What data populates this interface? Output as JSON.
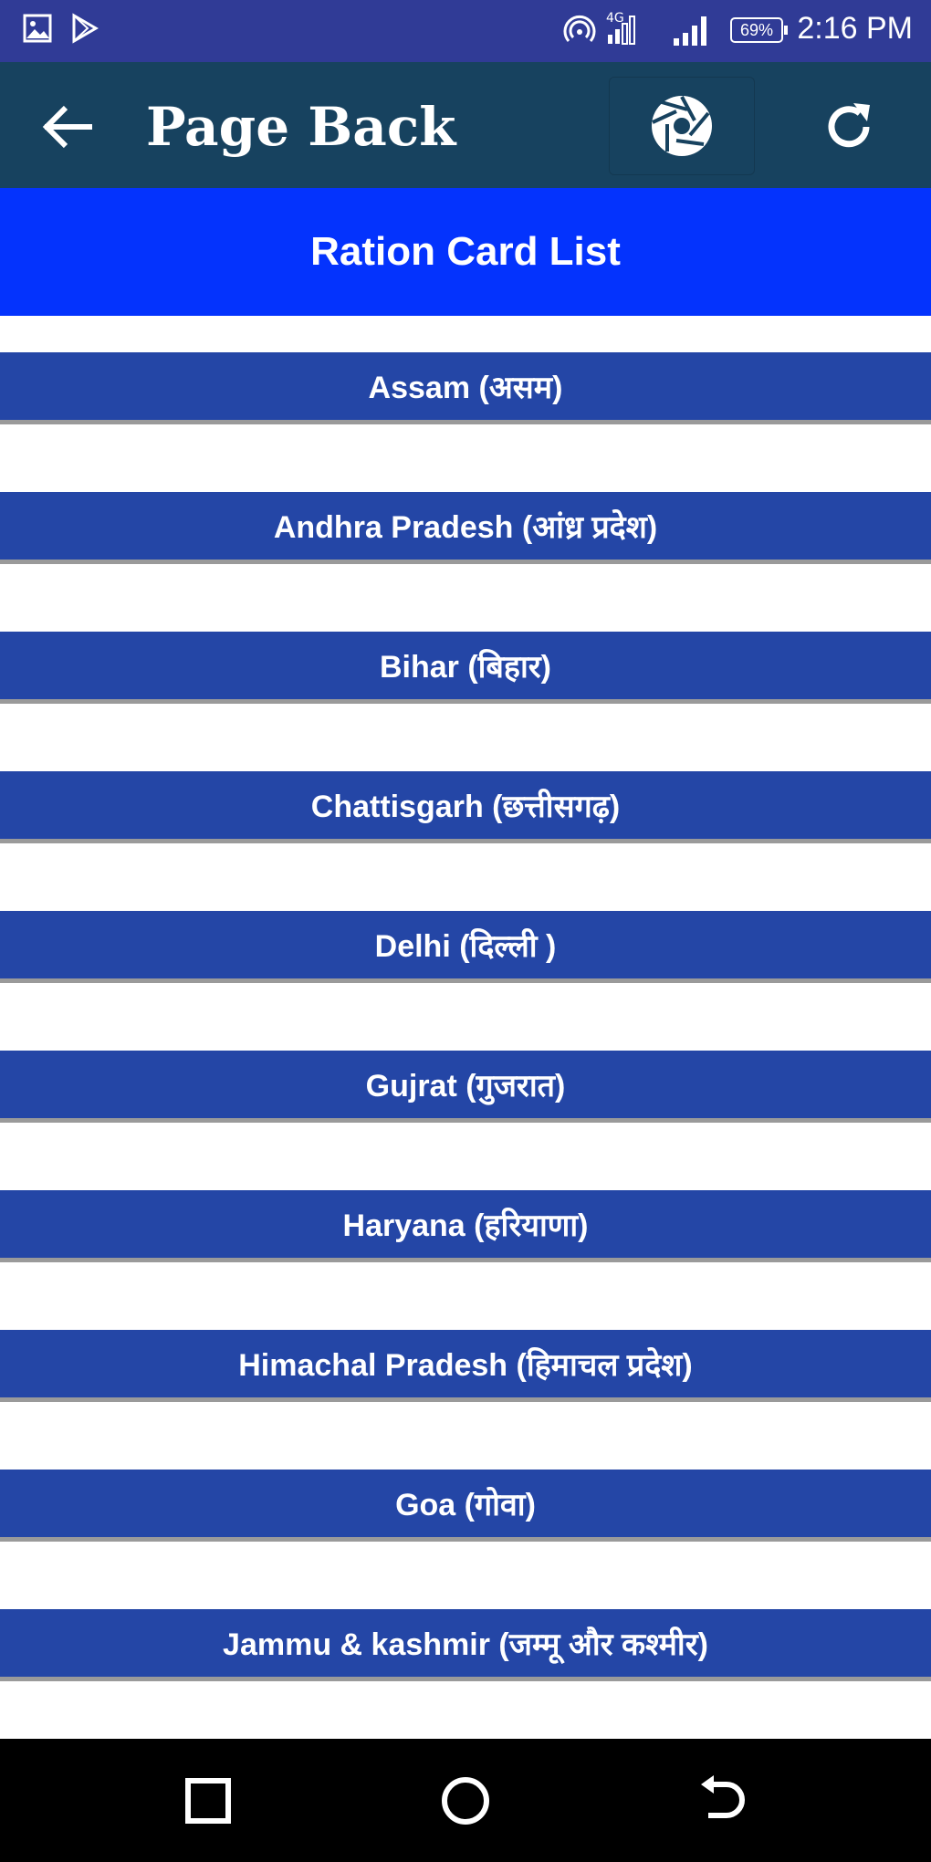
{
  "status_bar": {
    "time": "2:16 PM",
    "battery": "69%",
    "icons": [
      "image-icon",
      "play-store-icon",
      "hotspot-icon",
      "signal-4g-icon",
      "signal-bars-icon",
      "battery-icon"
    ]
  },
  "app_bar": {
    "title": "Page Back",
    "icons": [
      "back-arrow-icon",
      "camera-shutter-icon",
      "refresh-icon"
    ]
  },
  "header": {
    "title": "Ration Card List"
  },
  "states": [
    {
      "label": "Assam (असम)"
    },
    {
      "label": "Andhra Pradesh (आंध्र प्रदेश)"
    },
    {
      "label": "Bihar (बिहार)"
    },
    {
      "label": "Chattisgarh (छत्तीसगढ़)"
    },
    {
      "label": "Delhi (दिल्ली )"
    },
    {
      "label": "Gujrat (गुजरात)"
    },
    {
      "label": "Haryana (हरियाणा)"
    },
    {
      "label": "Himachal Pradesh (हिमाचल प्रदेश)"
    },
    {
      "label": "Goa (गोवा)"
    },
    {
      "label": "Jammu & kashmir (जम्मू और कश्मीर)"
    }
  ],
  "nav_bar": {
    "icons": [
      "recents-square-icon",
      "home-circle-icon",
      "back-nav-icon"
    ]
  },
  "colors": {
    "status_bar": "#303b96",
    "app_bar": "#17425f",
    "header_banner": "#0433fd",
    "list_item": "#2446a6",
    "nav_bar": "#000000"
  }
}
